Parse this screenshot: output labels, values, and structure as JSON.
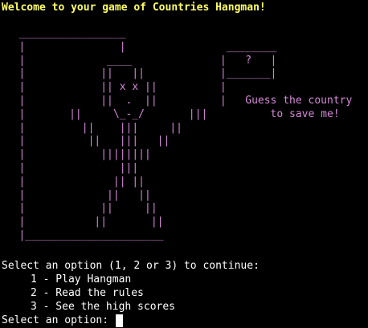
{
  "colors": {
    "background": "#000000",
    "welcome_text": "#ffff66",
    "art": "#d488d8",
    "menu_text": "#ffffff"
  },
  "header": {
    "welcome": "Welcome to your game of Countries Hangman!"
  },
  "art": {
    "lines": [
      "   _________________",
      "   |               |                ________",
      "   |             ____              |   ?   |",
      "   |            ||   ||            |_______|",
      "   |            || x x ||          |",
      "   |            ||  .  ||          |   Guess the country",
      "   |       ||     \\_-_/       |||          to save me!",
      "   |         ||    |||     ||",
      "   |          ||   |||   ||",
      "   |            ||||||||",
      "   |               |||",
      "   |              || ||",
      "   |             ||   ||",
      "   |            ||     ||",
      "   |           ||       ||",
      "   |______________________"
    ]
  },
  "menu": {
    "instruction": "Select an option (1, 2 or 3) to continue:",
    "options": [
      "1 - Play Hangman",
      "2 - Read the rules",
      "3 - See the high scores"
    ],
    "prompt": "Select an option: "
  }
}
